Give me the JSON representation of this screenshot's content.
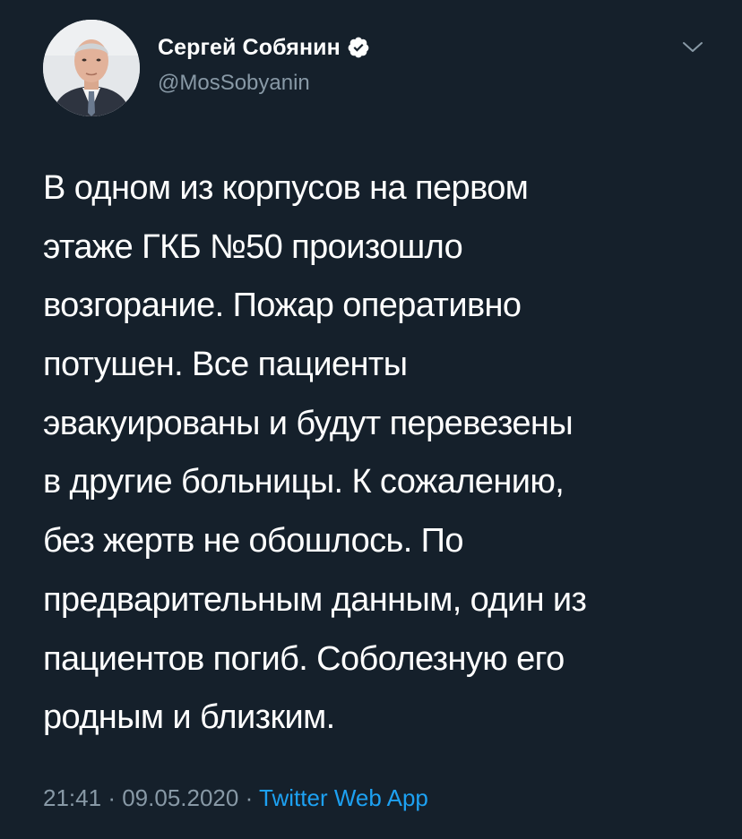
{
  "author": {
    "name": "Сергей Собянин",
    "handle": "@MosSobyanin",
    "verified": true,
    "avatar_icon": "person-portrait"
  },
  "tweet": {
    "lines": [
      "В одном из корпусов на первом",
      "этаже ГКБ №50 произошло",
      "возгорание. Пожар оперативно",
      "потушен. Все пациенты",
      "эвакуированы и будут перевезены",
      "в другие больницы. К сожалению,",
      "без жертв не обошлось. По",
      "предварительным данным, один из",
      "пациентов погиб. Соболезную его",
      "родным и близким."
    ]
  },
  "meta": {
    "time": "21:41",
    "separator": "·",
    "date": "09.05.2020",
    "source": "Twitter Web App"
  },
  "colors": {
    "background": "#15202b",
    "text": "#ffffff",
    "secondary": "#8899a6",
    "link": "#1da1f2"
  },
  "icons": {
    "verified": "verified-badge-icon",
    "menu": "chevron-down-icon"
  }
}
